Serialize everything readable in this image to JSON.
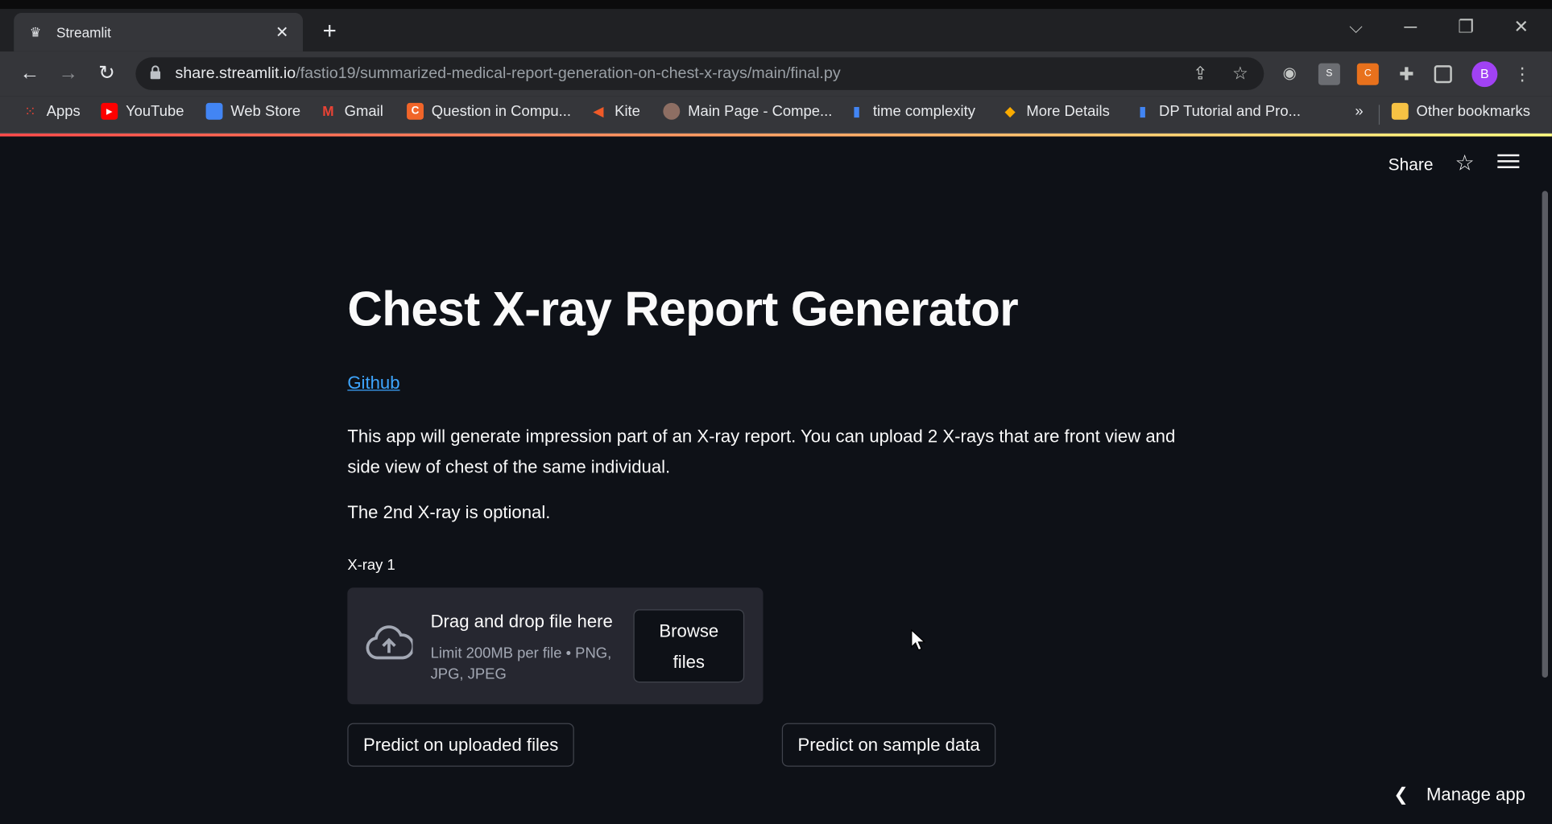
{
  "browser": {
    "tab_title": "Streamlit",
    "tab_close": "✕",
    "new_tab": "+",
    "url_host": "share.streamlit.io",
    "url_path": "/fastio19/summarized-medical-report-generation-on-chest-x-rays/main/final.py",
    "avatar_letter": "B",
    "window_controls": {
      "dropdown": "⌵",
      "minimize": "─",
      "restore": "❐",
      "close": "✕"
    },
    "nav": {
      "back": "←",
      "forward": "→",
      "reload": "↻"
    }
  },
  "bookmarks": {
    "items": [
      {
        "label": "Apps",
        "color": "#ea4335",
        "icon": "apps-grid-icon"
      },
      {
        "label": "YouTube",
        "color": "#ff0000",
        "icon": "youtube-icon"
      },
      {
        "label": "Web Store",
        "color": "#4285f4",
        "icon": "web-store-icon"
      },
      {
        "label": "Gmail",
        "color": "#ea4335",
        "icon": "gmail-icon"
      },
      {
        "label": "Question in Compu...",
        "color": "#f16529",
        "icon": "question-icon"
      },
      {
        "label": "Kite",
        "color": "#f05a28",
        "icon": "kite-icon"
      },
      {
        "label": "Main Page - Compe...",
        "color": "#8d6e63",
        "icon": "main-page-icon"
      },
      {
        "label": "time complexity",
        "color": "#4285f4",
        "icon": "chart-icon"
      },
      {
        "label": "More Details",
        "color": "#f9ab00",
        "icon": "more-details-icon"
      },
      {
        "label": "DP Tutorial and Pro...",
        "color": "#4285f4",
        "icon": "chart-icon"
      }
    ],
    "overflow": "»",
    "other": "Other bookmarks"
  },
  "header": {
    "share_label": "Share"
  },
  "main": {
    "title": "Chest X-ray Report Generator",
    "github_link": "Github",
    "description": "This app will generate impression part of an X-ray report. You can upload 2 X-rays that are front view and side view of chest of the same individual.",
    "optional_note": "The 2nd X-ray is optional.",
    "uploader": {
      "label": "X-ray 1",
      "drag_text": "Drag and drop file here",
      "limit_text": "Limit 200MB per file • PNG, JPG, JPEG",
      "browse_line1": "Browse",
      "browse_line2": "files"
    },
    "predict_uploaded": "Predict on uploaded files",
    "predict_sample": "Predict on sample data"
  },
  "footer": {
    "manage_app": "Manage app"
  },
  "colors": {
    "background": "#0e1117",
    "link": "#3ea6ff",
    "dropzone": "#262730",
    "accent": "#ff4b4b"
  }
}
